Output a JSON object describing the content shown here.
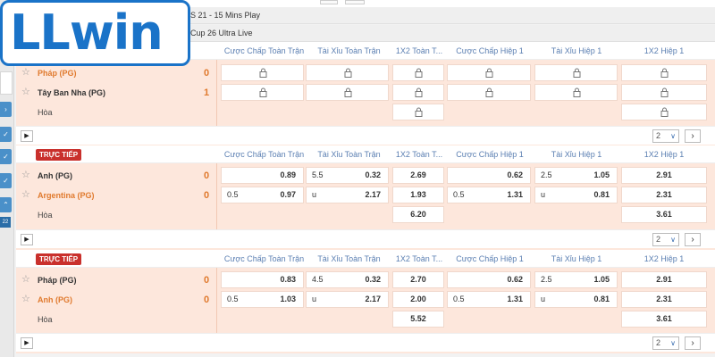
{
  "logo": {
    "text": "LLwin"
  },
  "leagues": [
    {
      "title": "S 21 - 15 Mins Play"
    },
    {
      "title": "Cup 26 Ultra Live"
    }
  ],
  "columns": [
    "Cược Chấp Toàn Trận",
    "Tài Xỉu Toàn Trận",
    "1X2 Toàn T...",
    "Cược Chấp Hiệp 1",
    "Tài Xỉu Hiệp 1",
    "1X2 Hiệp 1"
  ],
  "live_label": "TRỰC TIẾP",
  "left_rail": {
    "badge": "22"
  },
  "matches": [
    {
      "home": "Pháp (PG)",
      "home_score": "0",
      "away": "Tây Ban Nha (PG)",
      "away_score": "1",
      "draw": "Hòa",
      "locked": true,
      "pager": {
        "page": "2",
        "next": "›"
      }
    },
    {
      "home": "Anh (PG)",
      "home_score": "0",
      "away": "Argentina (PG)",
      "away_score": "0",
      "draw": "Hòa",
      "odds": {
        "home": {
          "hdp_line": "",
          "hdp": "0.89",
          "ou_line": "5.5",
          "ou": "0.32",
          "x12": "2.69",
          "h1_line": "",
          "h1": "0.62",
          "h1ou_line": "2.5",
          "h1ou": "1.05",
          "h1x12": "2.91"
        },
        "away": {
          "hdp_line": "0.5",
          "hdp": "0.97",
          "ou_line": "u",
          "ou": "2.17",
          "x12": "1.93",
          "h1_line": "0.5",
          "h1": "1.31",
          "h1ou_line": "u",
          "h1ou": "0.81",
          "h1x12": "2.31"
        },
        "draw": {
          "x12": "6.20",
          "h1x12": "3.61"
        }
      },
      "pager": {
        "page": "2",
        "next": "›"
      }
    },
    {
      "home": "Pháp (PG)",
      "home_score": "0",
      "away": "Anh (PG)",
      "away_score": "0",
      "draw": "Hòa",
      "odds": {
        "home": {
          "hdp_line": "",
          "hdp": "0.83",
          "ou_line": "4.5",
          "ou": "0.32",
          "x12": "2.70",
          "h1_line": "",
          "h1": "0.62",
          "h1ou_line": "2.5",
          "h1ou": "1.05",
          "h1x12": "2.91"
        },
        "away": {
          "hdp_line": "0.5",
          "hdp": "1.03",
          "ou_line": "u",
          "ou": "2.17",
          "x12": "2.00",
          "h1_line": "0.5",
          "h1": "1.31",
          "h1ou_line": "u",
          "h1ou": "0.81",
          "h1x12": "2.31"
        },
        "draw": {
          "x12": "5.52",
          "h1x12": "3.61"
        }
      },
      "pager": {
        "page": "2",
        "next": "›"
      }
    }
  ],
  "colors": {
    "brand": "#1a73c8",
    "accent": "#e07a2e",
    "live": "#c9302c",
    "row_bg": "#fde7dc",
    "header_text": "#5b7fb2"
  }
}
